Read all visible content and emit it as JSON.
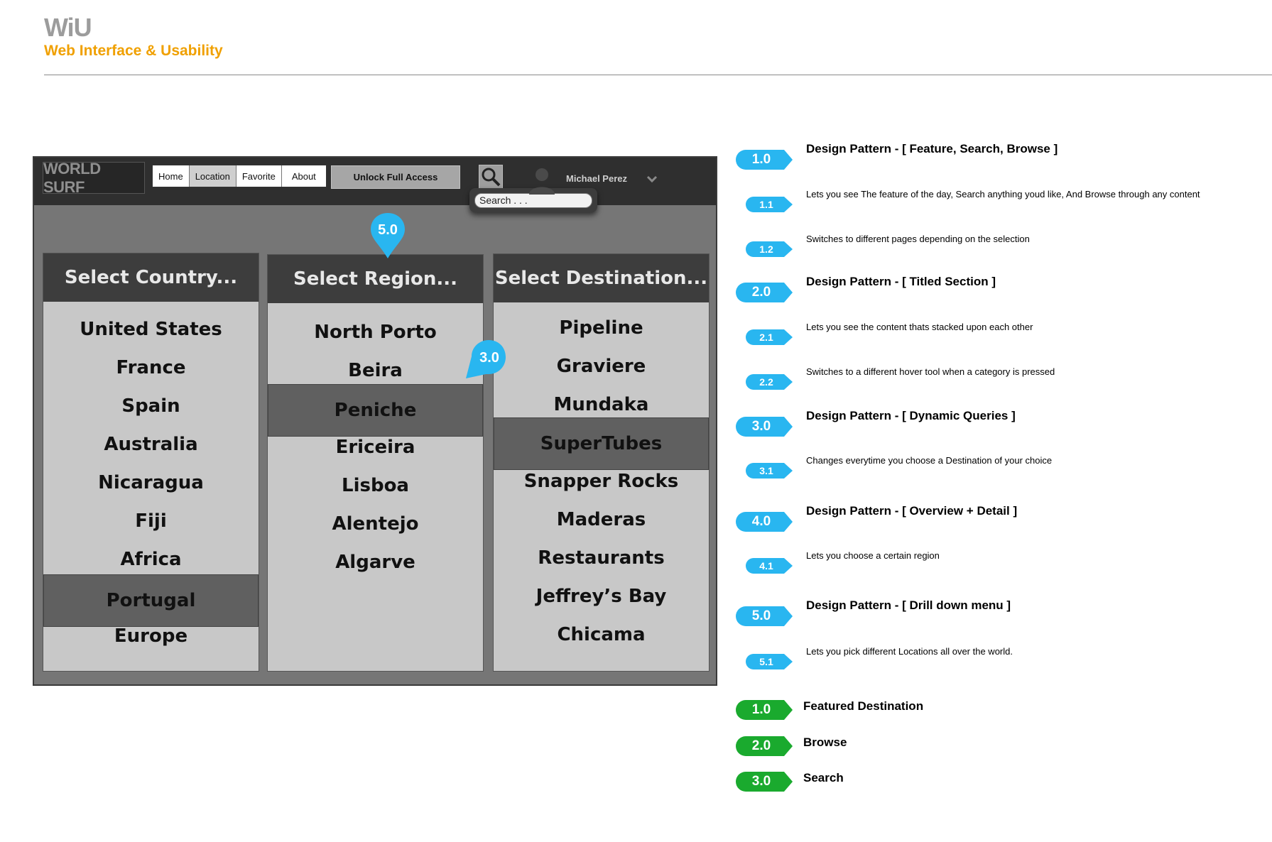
{
  "header": {
    "brand": "WiU",
    "subtitle": "Web Interface & Usability"
  },
  "mockup": {
    "logo": "WORLD SURF",
    "nav": [
      {
        "label": "Home",
        "active": false
      },
      {
        "label": "Location",
        "active": true
      },
      {
        "label": "Favorite",
        "active": false
      },
      {
        "label": "About",
        "active": false
      }
    ],
    "unlock_label": "Unlock Full Access",
    "search_placeholder": "Search . . .",
    "user_name": "Michael Perez",
    "columns": {
      "country": {
        "title": "Select Country...",
        "items": [
          "United States",
          "France",
          "Spain",
          "Australia",
          "Nicaragua",
          "Fiji",
          "Africa",
          "Portugal",
          "Europe"
        ],
        "selected": "Portugal"
      },
      "region": {
        "title": "Select Region...",
        "items": [
          "North Porto",
          "Beira",
          "Peniche",
          "Ericeira",
          "Lisboa",
          "Alentejo",
          "Algarve"
        ],
        "selected": "Peniche"
      },
      "destination": {
        "title": "Select Destination...",
        "items": [
          "Pipeline",
          "Graviere",
          "Mundaka",
          "SuperTubes",
          "Snapper Rocks",
          "Maderas",
          "Restaurants",
          "Jeffrey’s Bay",
          "Chicama"
        ],
        "selected": "SuperTubes"
      }
    },
    "callouts": {
      "region_pin": "5.0",
      "destination_pin": "3.0"
    }
  },
  "legend": {
    "colors": {
      "blue": "#29b6f0",
      "green": "#1aaa2e"
    },
    "blue": [
      {
        "num": "1.0",
        "text": "Design Pattern - [ Feature, Search, Browse ]",
        "kind": "title"
      },
      {
        "num": "1.1",
        "text": "Lets you see The feature of the day, Search anything youd like, And Browse through any content",
        "kind": "desc"
      },
      {
        "num": "1.2",
        "text": "Switches to different pages depending on the selection",
        "kind": "desc"
      },
      {
        "num": "2.0",
        "text": "Design Pattern - [ Titled Section  ]",
        "kind": "title"
      },
      {
        "num": "2.1",
        "text": "Lets you see the content thats stacked upon each other",
        "kind": "desc"
      },
      {
        "num": "2.2",
        "text": "Switches to a different hover tool when a category is pressed",
        "kind": "desc"
      },
      {
        "num": "3.0",
        "text": "Design Pattern - [ Dynamic Queries ]",
        "kind": "title"
      },
      {
        "num": "3.1",
        "text": "Changes everytime you choose a Destination of your choice",
        "kind": "desc"
      },
      {
        "num": "4.0",
        "text": "Design Pattern - [ Overview + Detail ]",
        "kind": "title"
      },
      {
        "num": "4.1",
        "text": "Lets you choose a certain region",
        "kind": "desc"
      },
      {
        "num": "5.0",
        "text": "Design Pattern - [ Drill down menu ]",
        "kind": "title"
      },
      {
        "num": "5.1",
        "text": "Lets you pick different Locations all over the world.",
        "kind": "desc"
      }
    ],
    "green": [
      {
        "num": "1.0",
        "text": "Featured Destination"
      },
      {
        "num": "2.0",
        "text": "Browse"
      },
      {
        "num": "3.0",
        "text": "Search"
      }
    ]
  }
}
